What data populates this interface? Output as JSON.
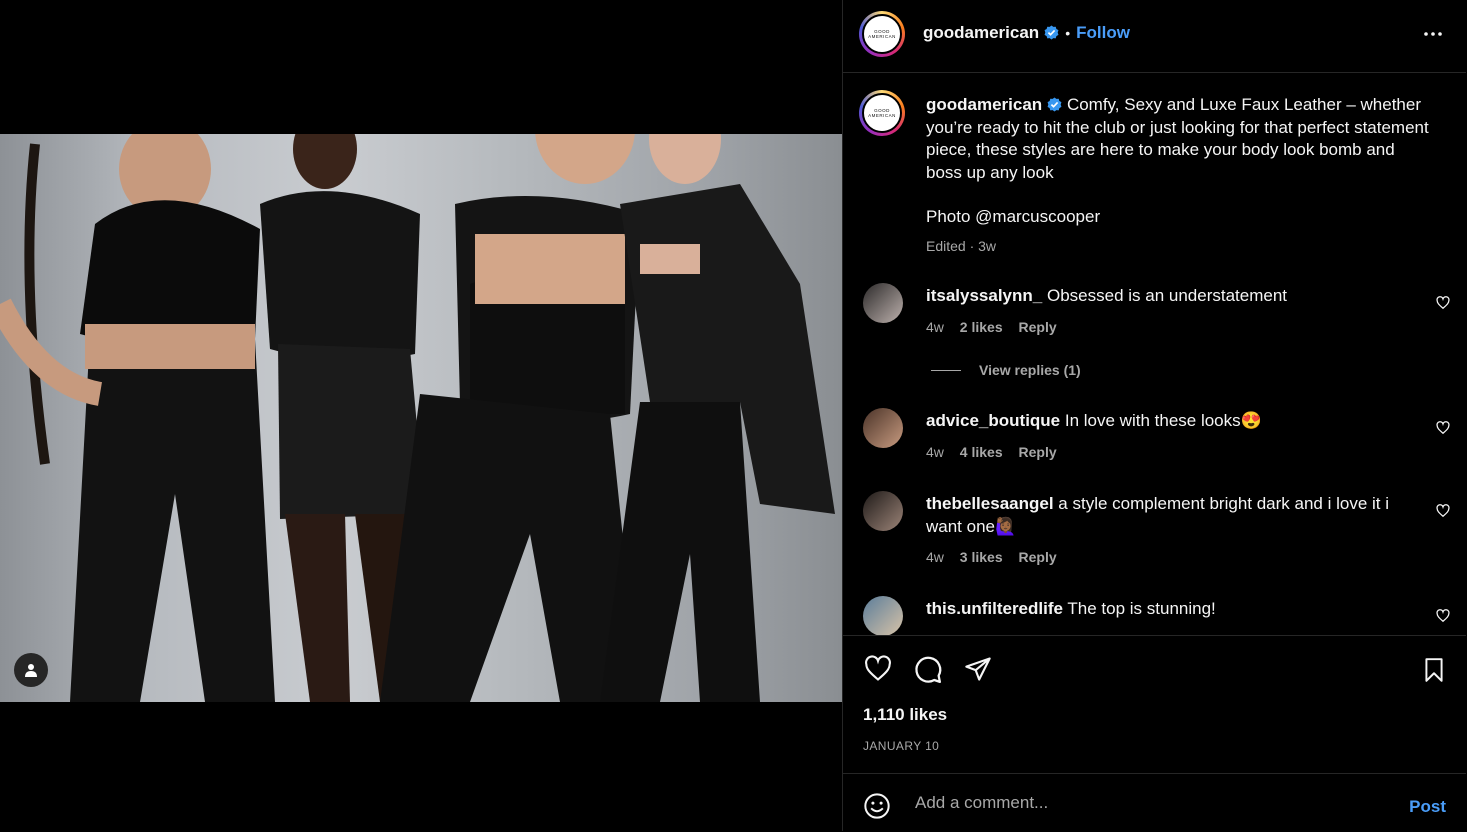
{
  "post": {
    "username": "goodamerican",
    "follow_label": "Follow",
    "dot": "•",
    "avatar_text": "GOOD AMERICAN"
  },
  "caption": {
    "username": "goodamerican",
    "text": "Comfy, Sexy and Luxe Faux Leather – whether you’re ready to hit the club or just looking for that perfect statement piece, these styles are here to make your body look bomb and boss up any look",
    "photo_credit": "Photo @marcuscooper",
    "meta": "Edited · 3w"
  },
  "comments": [
    {
      "username": "itsalyssalynn_",
      "text": "Obsessed is an understatement",
      "time": "4w",
      "likes": "2 likes",
      "reply": "Reply"
    },
    {
      "username": "advice_boutique",
      "text": "In love with these looks😍",
      "time": "4w",
      "likes": "4 likes",
      "reply": "Reply"
    },
    {
      "username": "thebellesaangel",
      "text": "a style complement bright dark and i love it i want one🙋🏾‍♀️",
      "time": "4w",
      "likes": "3 likes",
      "reply": "Reply"
    },
    {
      "username": "this.unfilteredlife",
      "text": "The top is stunning!"
    }
  ],
  "view_replies": "View replies (1)",
  "likes_count": "1,110 likes",
  "date": "JANUARY 10",
  "add_comment": {
    "placeholder": "Add a comment...",
    "post_label": "Post"
  },
  "icons": {
    "more": "more-horizontal-icon",
    "like": "heart-icon",
    "comment": "comment-icon",
    "share": "send-icon",
    "save": "bookmark-icon",
    "emoji": "emoji-icon",
    "tag": "user-tag-icon"
  },
  "colors": {
    "accent": "#4a9df8",
    "secondary_text": "#a8a8a8",
    "divider": "#262626",
    "background": "#000000"
  }
}
